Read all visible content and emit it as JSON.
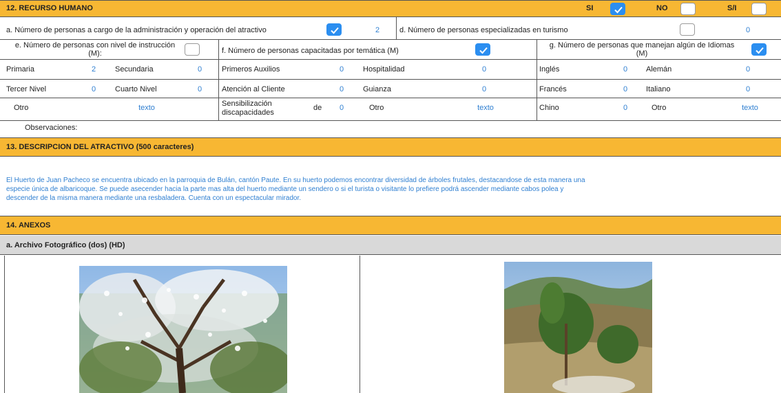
{
  "s12": {
    "title": "12. RECURSO HUMANO",
    "si_label": "SI",
    "si_checked": true,
    "no_label": "NO",
    "no_checked": false,
    "sn_label": "S/I",
    "sn_checked": false
  },
  "row_a": {
    "label": "a. Número de personas a cargo de la administración y operación del atractivo",
    "checked": true,
    "value": "2",
    "d_label": "d. Número de personas especializadas en turismo",
    "d_checked": false,
    "d_value": "0"
  },
  "row_e": {
    "e_label": "e. Número de personas con nivel de instrucción (M):",
    "e_checked": false,
    "f_label": "f. Número de personas capacitadas por temática (M)",
    "f_checked": true,
    "g_label": "g. Número de personas que manejan algún de Idiomas (M)",
    "g_checked": true
  },
  "instruccion": {
    "primaria": "Primaria",
    "primaria_v": "2",
    "secundaria": "Secundaria",
    "secundaria_v": "0",
    "tercer": "Tercer Nivel",
    "tercer_v": "0",
    "cuarto": "Cuarto Nivel",
    "cuarto_v": "0",
    "otro": "Otro",
    "otro_v": "texto"
  },
  "tematica": {
    "primeros": "Primeros Auxilios",
    "primeros_v": "0",
    "hospitalidad": "Hospitalidad",
    "hospitalidad_v": "0",
    "atencion": "Atención al Cliente",
    "atencion_v": "0",
    "guianza": "Guianza",
    "guianza_v": "0",
    "sensib_1": "Sensibilización",
    "sensib_de": "de",
    "sensib_2": "discapacidades",
    "sensib_v": "0",
    "otro": "Otro",
    "otro_v": "texto"
  },
  "idiomas": {
    "ingles": "Inglés",
    "ingles_v": "0",
    "aleman": "Alemán",
    "aleman_v": "0",
    "frances": "Francés",
    "frances_v": "0",
    "italiano": "Italiano",
    "italiano_v": "0",
    "chino": "Chino",
    "chino_v": "0",
    "otro": "Otro",
    "otro_v": "texto"
  },
  "observaciones": "Observaciones:",
  "s13": {
    "title": "13. DESCRIPCION DEL ATRACTIVO (500 caracteres)",
    "line1": "El Huerto de Juan Pacheco se encuentra ubicado en la parroquia de Bulán, cantón Paute. En su huerto podemos encontrar diversidad de árboles frutales, destacandose de esta manera una",
    "line2": "especie única de albaricoque. Se puede asecender hacia la parte mas alta del huerto mediante un sendero o si el turista o visitante lo prefiere podrá ascender mediante cabos polea y",
    "line3": "descender  de la misma manera mediante una resbaladera. Cuenta con un espectacular mirador."
  },
  "s14": {
    "title": "14. ANEXOS",
    "sub": "a. Archivo Fotográfico (dos) (HD)"
  },
  "colors": {
    "header_orange": "#f7b733",
    "subheader_grey": "#d9d9d9",
    "value_blue": "#2f7fd1",
    "checkbox_blue": "#2b8ef0"
  }
}
